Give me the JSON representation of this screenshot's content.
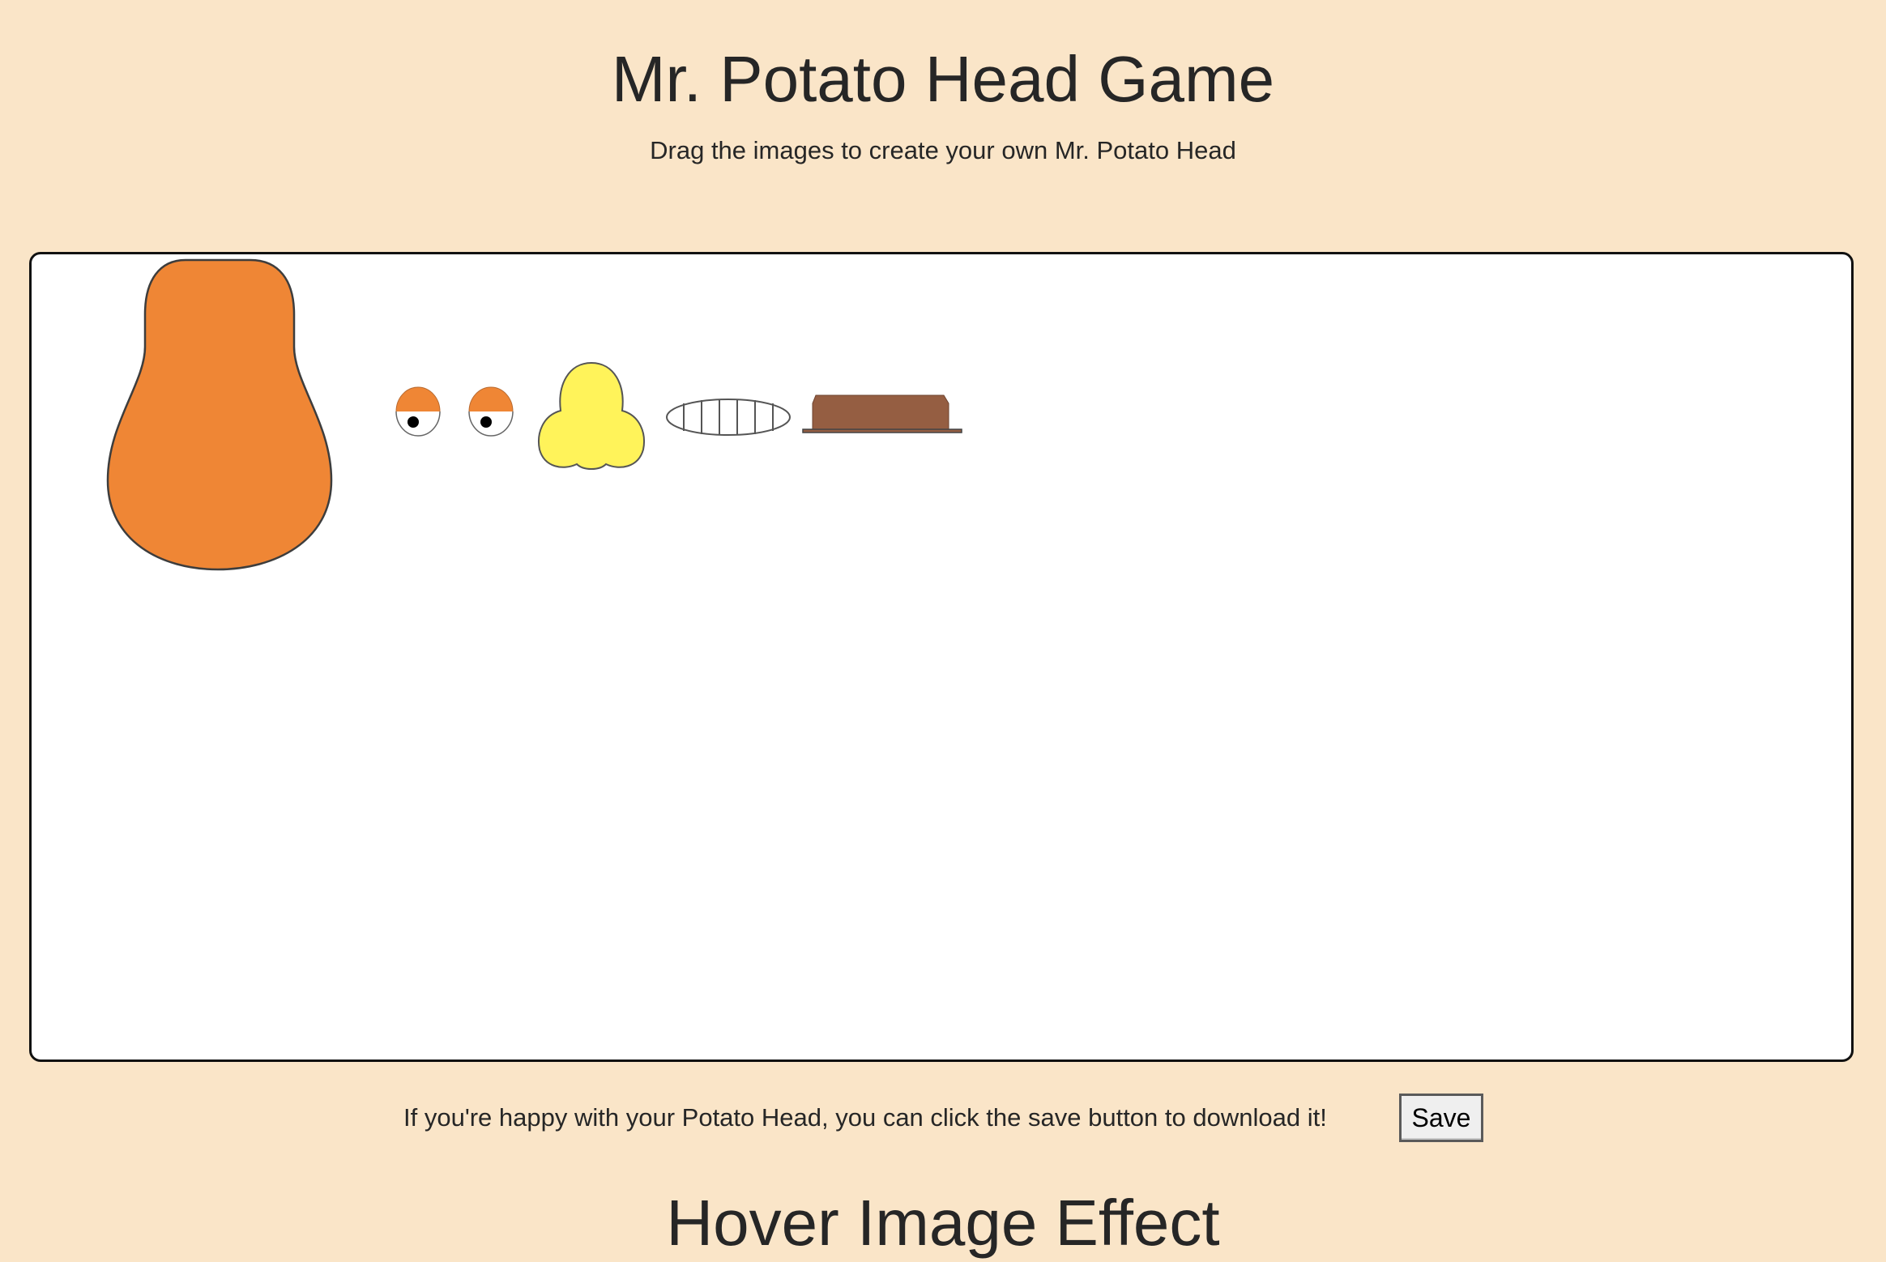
{
  "header": {
    "title": "Mr. Potato Head Game",
    "subtitle": "Drag the images to create your own Mr. Potato Head"
  },
  "parts": [
    {
      "name": "potato-body",
      "color": "#ef8635"
    },
    {
      "name": "left-eye",
      "color": "#ef8635"
    },
    {
      "name": "right-eye",
      "color": "#ef8635"
    },
    {
      "name": "nose",
      "color": "#fff35a"
    },
    {
      "name": "mouth",
      "color": "#ffffff"
    },
    {
      "name": "hat",
      "color": "#955e42"
    }
  ],
  "save_section": {
    "message": "If you're happy with your Potato Head, you can click the save button to download it!",
    "button_label": "Save"
  },
  "next_section": {
    "heading": "Hover Image Effect"
  }
}
